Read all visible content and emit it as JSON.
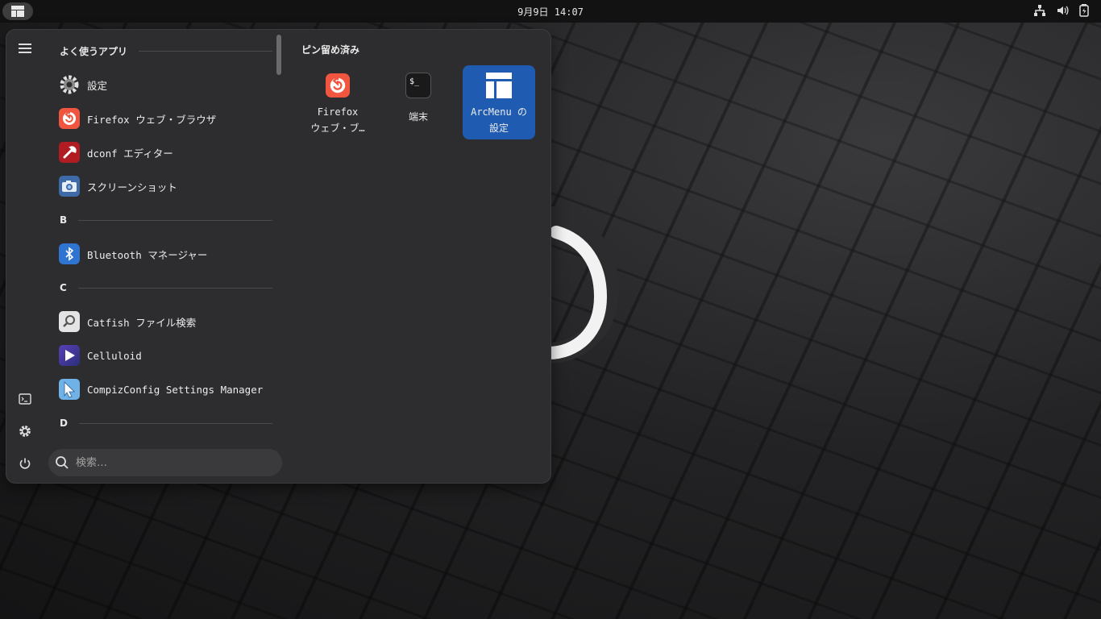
{
  "topbar": {
    "clock": "9月9日 14:07",
    "tray_icons": [
      "network-icon",
      "volume-icon",
      "battery-icon"
    ]
  },
  "menu": {
    "rail": {
      "items": [
        "hamburger-icon",
        "terminal-icon",
        "settings-icon",
        "power-icon"
      ]
    },
    "frequent": {
      "header": "よく使うアプリ",
      "items": [
        {
          "label": "設定",
          "icon": "gear-icon"
        },
        {
          "label": "Firefox ウェブ・ブラウザ",
          "icon": "firefox-icon"
        },
        {
          "label": "dconf エディター",
          "icon": "dconf-icon"
        },
        {
          "label": "スクリーンショット",
          "icon": "camera-icon"
        }
      ]
    },
    "sections": [
      {
        "header": "B",
        "items": [
          {
            "label": "Bluetooth マネージャー",
            "icon": "bluetooth-icon"
          }
        ]
      },
      {
        "header": "C",
        "items": [
          {
            "label": "Catfish ファイル検索",
            "icon": "magnifier-icon"
          },
          {
            "label": "Celluloid",
            "icon": "play-icon"
          },
          {
            "label": "CompizConfig Settings Manager",
            "icon": "cursor-icon"
          }
        ]
      },
      {
        "header": "D",
        "items": []
      }
    ],
    "search": {
      "placeholder": "検索…"
    },
    "pinned": {
      "header": "ピン留め済み",
      "items": [
        {
          "line1": "Firefox",
          "line2": "ウェブ・ブ…",
          "icon": "firefox-icon"
        },
        {
          "line1": "端末",
          "line2": "",
          "icon": "terminal-icon"
        },
        {
          "line1": "ArcMenu の",
          "line2": "設定",
          "icon": "arcmenu-icon",
          "selected": true
        }
      ]
    }
  },
  "colors": {
    "accent": "#1f5bb0",
    "panel": "#2d2d2f",
    "topbar": "#121212"
  }
}
